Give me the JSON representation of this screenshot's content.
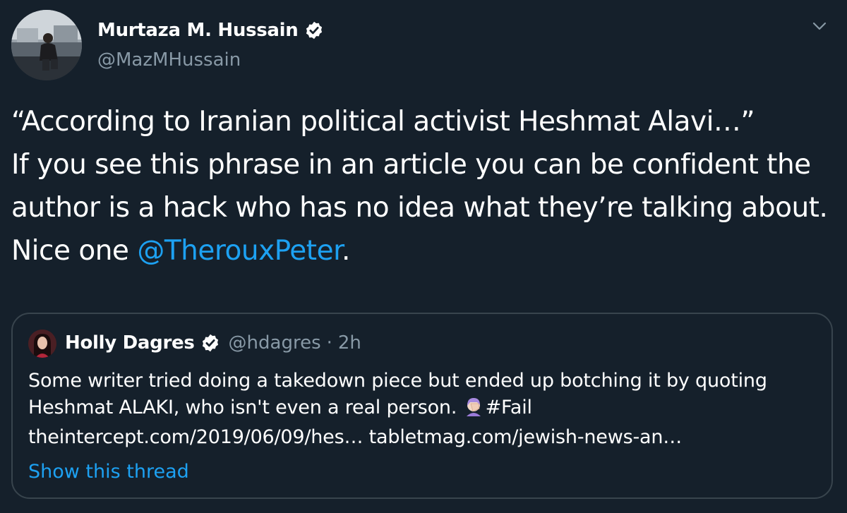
{
  "tweet": {
    "author_name": "Murtaza M. Hussain",
    "author_handle": "@MazMHussain",
    "text_before_mention": "“According to Iranian political activist Heshmat Alavi…”\nIf you see this phrase in an article you can be confident the author is a hack who has no idea what they’re talking about. Nice one ",
    "mention": "@TherouxPeter",
    "text_after_mention": "."
  },
  "quoted_tweet": {
    "author_name": "Holly Dagres",
    "author_handle": "@hdagres",
    "separator": "·",
    "time": "2h",
    "line1": "Some writer tried doing a takedown piece but ended up botching it by quoting",
    "line2_text": "Heshmat ALAKI, who isn't even a real person.",
    "hashtag": "#Fail",
    "link1": "theintercept.com/2019/06/09/hes…",
    "link2": "tabletmag.com/jewish-news-an…",
    "show_thread": "Show this thread"
  },
  "icons": {
    "verified": "verified-badge-icon",
    "caret": "chevron-down-icon",
    "facepalm": "facepalm-emoji-icon"
  },
  "colors": {
    "background": "#15202b",
    "text": "#ffffff",
    "secondary": "#8899a6",
    "link": "#1da1f2",
    "border": "#38444d"
  }
}
